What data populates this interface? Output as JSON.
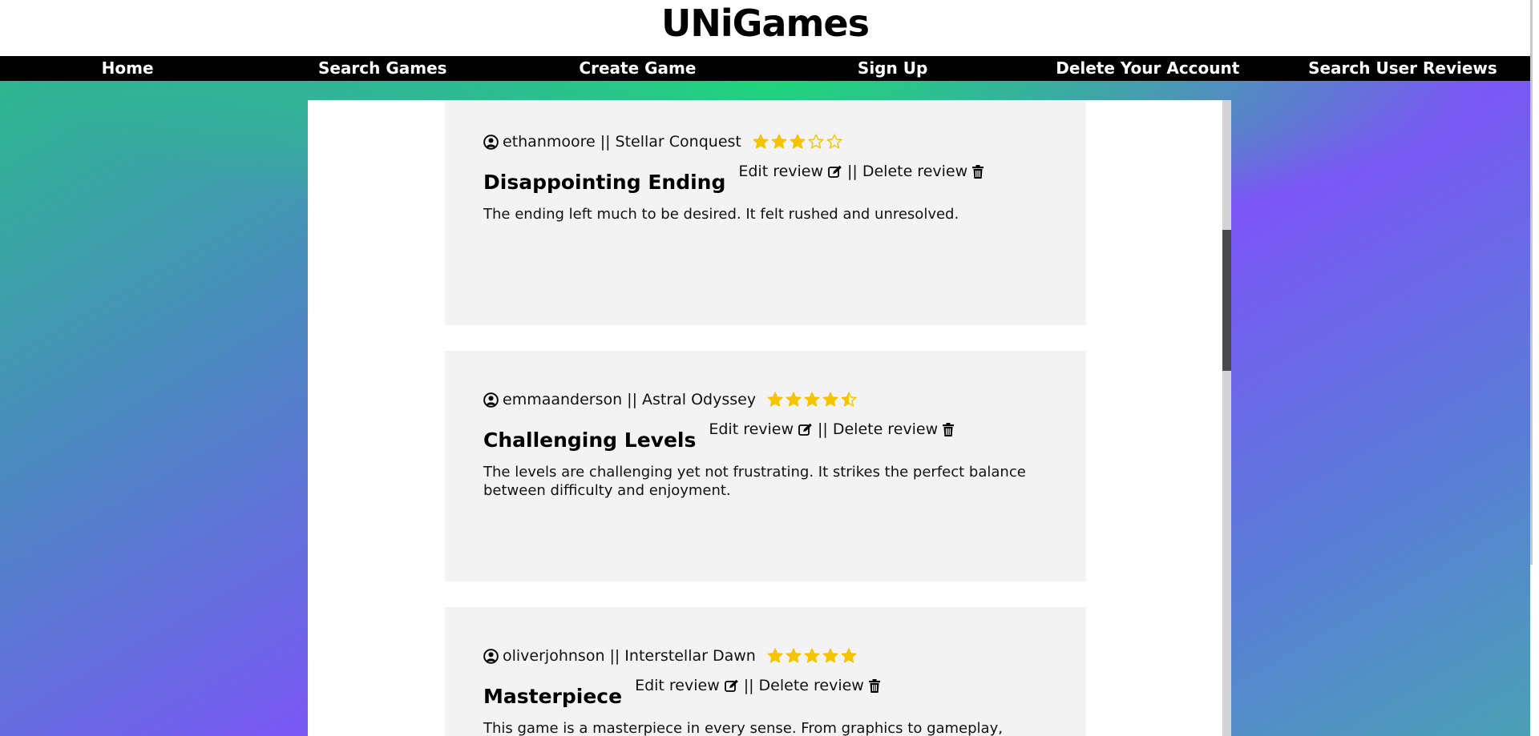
{
  "site": {
    "title": "UNiGames"
  },
  "nav": {
    "items": [
      {
        "label": "Home"
      },
      {
        "label": "Search Games"
      },
      {
        "label": "Create Game"
      },
      {
        "label": "Sign Up"
      },
      {
        "label": "Delete Your Account"
      },
      {
        "label": "Search User Reviews"
      }
    ]
  },
  "colors": {
    "star": "#f5c400",
    "card_bg": "#f3f3f3",
    "nav_bg": "#000000",
    "gradient_top": "#1ed67a",
    "gradient_mid": "#7b55f6"
  },
  "icons": {
    "user": "user-circle-icon",
    "edit": "edit-icon",
    "delete": "trash-icon",
    "star": "star-icon"
  },
  "reviews": [
    {
      "username": "ethanmoore",
      "separator": "||",
      "game": "Stellar Conquest",
      "rating": 3,
      "title": "Disappointing Ending",
      "edit_label": "Edit review",
      "delete_label": "Delete review",
      "body": "The ending left much to be desired. It felt rushed and unresolved."
    },
    {
      "username": "emmaanderson",
      "separator": "||",
      "game": "Astral Odyssey",
      "rating": 4.5,
      "title": "Challenging Levels",
      "edit_label": "Edit review",
      "delete_label": "Delete review",
      "body": "The levels are challenging yet not frustrating. It strikes the perfect balance between difficulty and enjoyment."
    },
    {
      "username": "oliverjohnson",
      "separator": "||",
      "game": "Interstellar Dawn",
      "rating": 5,
      "title": "Masterpiece",
      "edit_label": "Edit review",
      "delete_label": "Delete review",
      "body": "This game is a masterpiece in every sense. From graphics to gameplay, everything"
    }
  ]
}
